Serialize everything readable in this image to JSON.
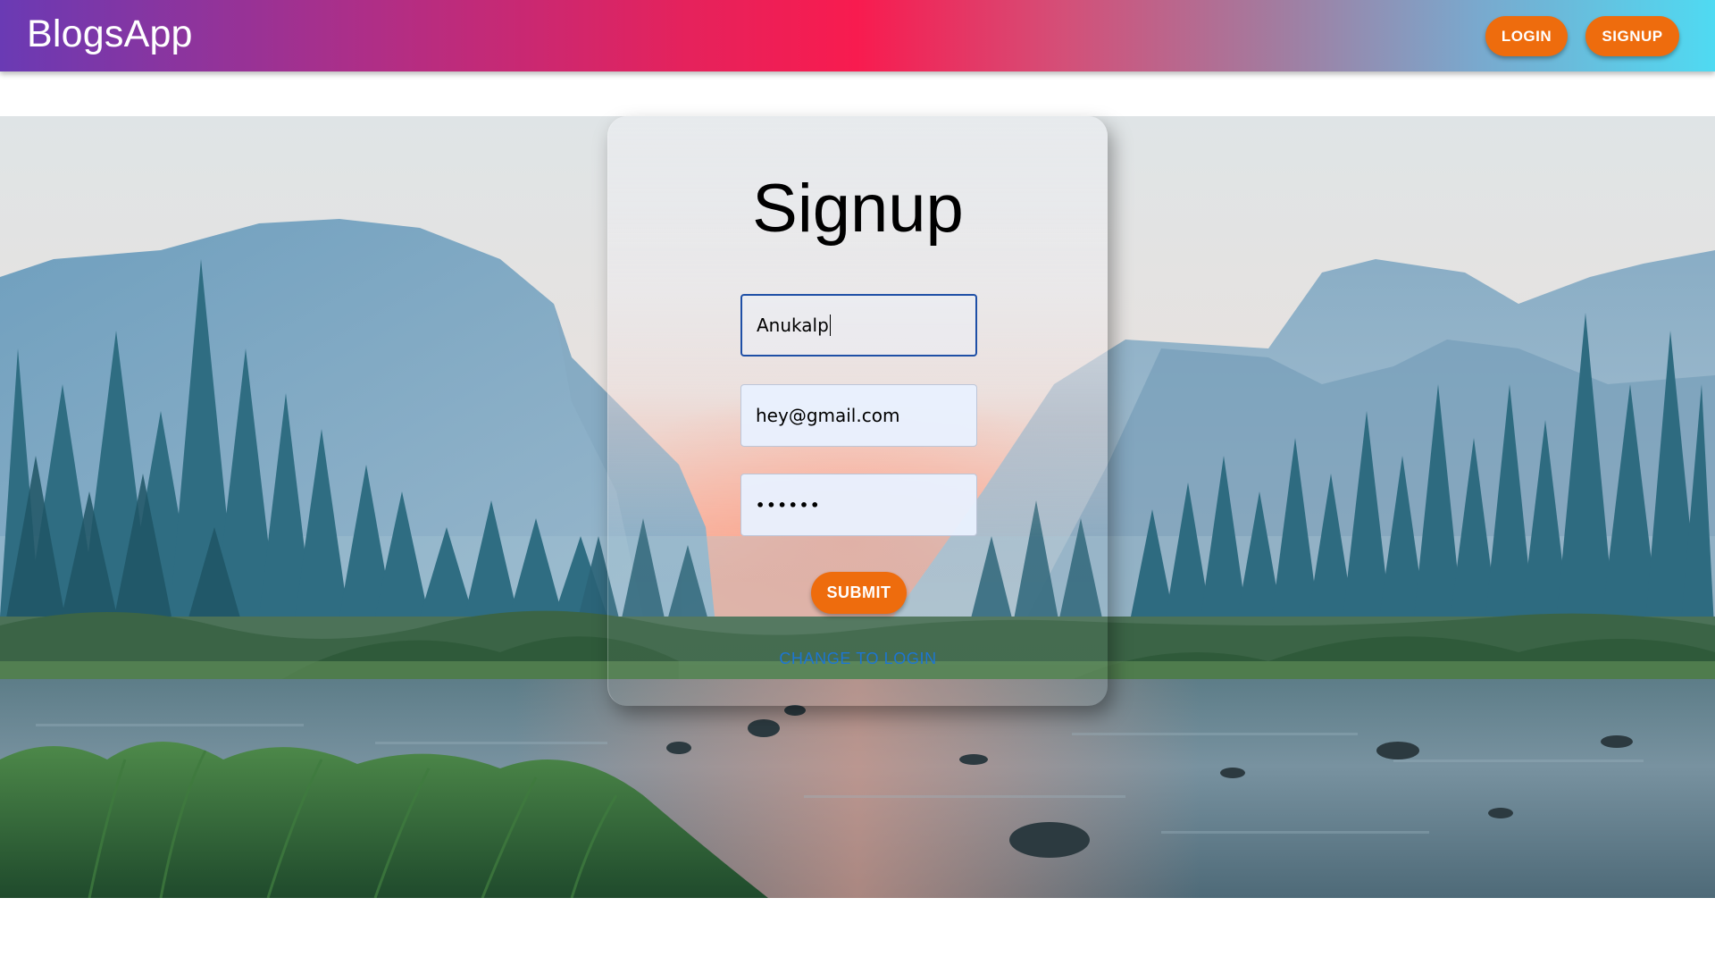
{
  "appbar": {
    "brand": "BlogsApp",
    "login_label": "LOGIN",
    "signup_label": "SIGNUP"
  },
  "form": {
    "title": "Signup",
    "name_value": "Anukalp",
    "email_value": "hey@gmail.com",
    "password_value": "••••••",
    "submit_label": "SUBMIT",
    "switch_label": "CHANGE TO LOGIN"
  },
  "colors": {
    "accent_orange": "#ee6c0d",
    "link_blue": "#1d76d2",
    "focus_border": "#1e4fa6"
  },
  "background_scene": "valley-landscape-image"
}
